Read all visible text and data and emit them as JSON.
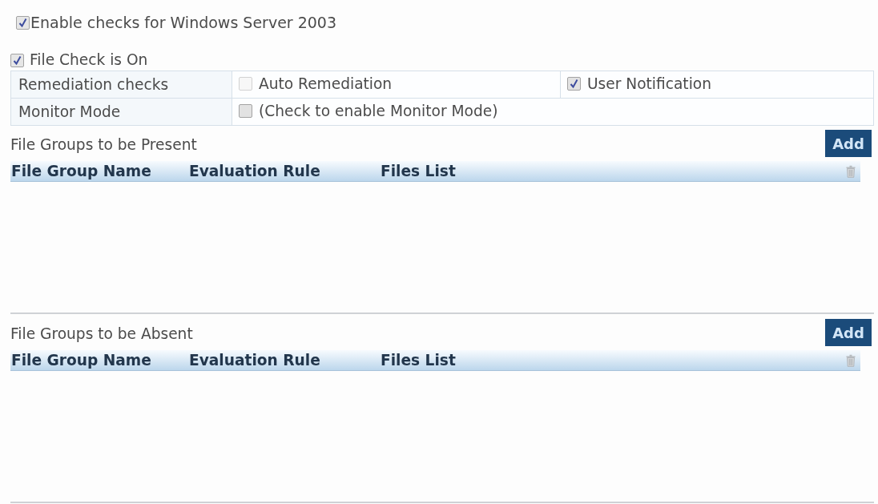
{
  "enable_checks": {
    "label": "Enable checks for Windows Server 2003",
    "checked": true
  },
  "file_check": {
    "label": "File Check is On",
    "checked": true
  },
  "settings": [
    {
      "label": "Remediation checks",
      "options": [
        {
          "label": "Auto Remediation",
          "checked": false,
          "disabled": true
        },
        {
          "label": "User Notification",
          "checked": true,
          "disabled": false
        }
      ]
    },
    {
      "label": "Monitor Mode",
      "options": [
        {
          "label": "(Check to enable Monitor Mode)",
          "checked": false,
          "disabled": false
        }
      ]
    }
  ],
  "file_groups": [
    {
      "title": "File Groups to be Present",
      "add_button": "Add",
      "columns": [
        "File Group Name",
        "Evaluation Rule",
        "Files List"
      ]
    },
    {
      "title": "File Groups to be Absent",
      "add_button": "Add",
      "columns": [
        "File Group Name",
        "Evaluation Rule",
        "Files List"
      ]
    }
  ]
}
